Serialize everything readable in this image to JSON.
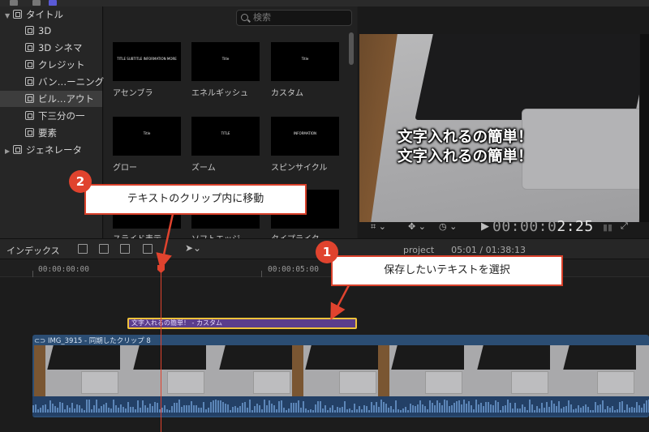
{
  "sidebar": {
    "items": [
      {
        "label": "タイトル",
        "expanded": true,
        "level": 0
      },
      {
        "label": "3D",
        "level": 1
      },
      {
        "label": "3D シネマ",
        "level": 1
      },
      {
        "label": "クレジット",
        "level": 1
      },
      {
        "label": "バン…ーニング",
        "level": 1
      },
      {
        "label": "ビル…アウト",
        "level": 1,
        "selected": true
      },
      {
        "label": "下三分の一",
        "level": 1
      },
      {
        "label": "要素",
        "level": 1
      },
      {
        "label": "ジェネレータ",
        "expanded": false,
        "level": 0
      }
    ]
  },
  "browser": {
    "search_placeholder": "検索",
    "thumbnails": [
      {
        "label": "アセンブラ",
        "preview": "TITLE SUBTITLE INFORMATION MORE"
      },
      {
        "label": "エネルギッシュ",
        "preview": "Title"
      },
      {
        "label": "カスタム",
        "preview": "Title"
      },
      {
        "label": "グロー",
        "preview": "Title"
      },
      {
        "label": "ズーム",
        "preview": "TITLE"
      },
      {
        "label": "スピンサイクル",
        "preview": "INFORMATION"
      },
      {
        "label": "スライド表示",
        "preview": ""
      },
      {
        "label": "ソフトエッジ",
        "preview": ""
      },
      {
        "label": "タイプライタ",
        "preview": ""
      }
    ]
  },
  "viewer": {
    "caption_line1": "文字入れるの簡単！",
    "caption_line2": "文字入れるの簡単！",
    "timecode_dim": "00:00:0",
    "timecode_bright": "2:25"
  },
  "timeline_toolbar": {
    "index_label": "インデックス",
    "project_name": "project",
    "project_time": "05:01 / 01:38:13"
  },
  "timeline": {
    "ruler_ticks": [
      "00:00:00:00",
      "00:00:05:00"
    ],
    "title_clip_label": "文字入れるの簡単！ - カスタム",
    "video_clip_label": "IMG_3915 - 同期したクリップ 8"
  },
  "annotations": [
    {
      "number": "1",
      "text": "保存したいテキストを選択"
    },
    {
      "number": "2",
      "text": "テキストのクリップ内に移動"
    }
  ],
  "colors": {
    "accent_red": "#e0432e",
    "title_clip": "#5b3d8c",
    "selection_yellow": "#f0c23b",
    "video_track": "#2b4d73"
  }
}
